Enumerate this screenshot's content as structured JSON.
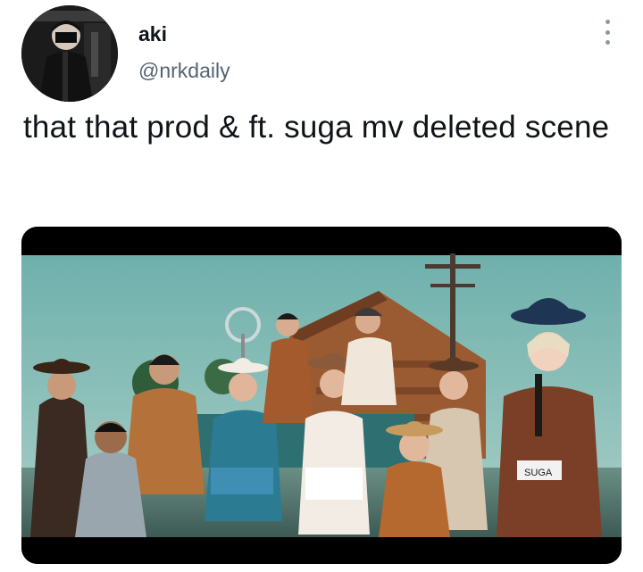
{
  "tweet": {
    "author": {
      "display_name": "aki",
      "handle": "@nrkdaily",
      "avatar_icon": "profile-photo"
    },
    "more_icon": "more-vertical-icon",
    "text": "that that prod & ft. suga mv deleted scene",
    "media": {
      "type": "photo",
      "sign_text": "SUGA"
    }
  },
  "colors": {
    "name": "#0f1419",
    "handle": "#536471",
    "icon": "#8b98a5",
    "sky": "#5a9e9b"
  }
}
